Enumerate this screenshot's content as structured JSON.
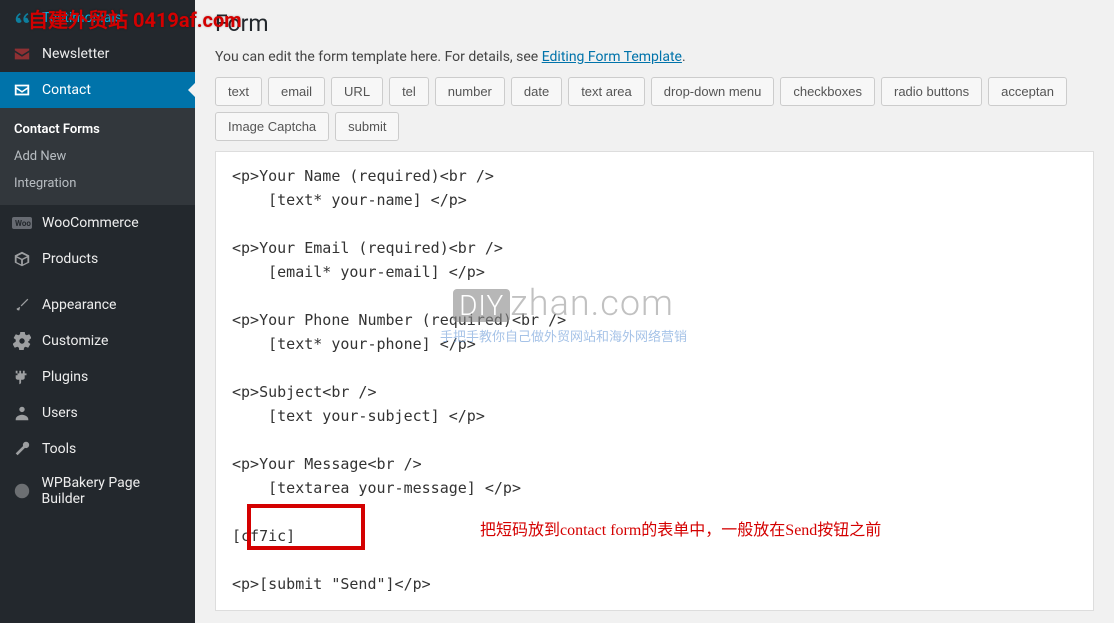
{
  "top_watermark": "自建外贸站 0419af.com",
  "sidebar": {
    "items": [
      {
        "label": "Testimonials",
        "icon": "quote"
      },
      {
        "label": "Newsletter",
        "icon": "mail"
      },
      {
        "label": "Contact",
        "icon": "envelope",
        "active": true
      },
      {
        "label": "WooCommerce",
        "icon": "woo"
      },
      {
        "label": "Products",
        "icon": "box"
      },
      {
        "label": "Appearance",
        "icon": "brush"
      },
      {
        "label": "Customize",
        "icon": "gear"
      },
      {
        "label": "Plugins",
        "icon": "plug"
      },
      {
        "label": "Users",
        "icon": "user"
      },
      {
        "label": "Tools",
        "icon": "wrench"
      },
      {
        "label": "WPBakery Page Builder",
        "icon": "wpb"
      }
    ],
    "submenu": [
      {
        "label": "Contact Forms",
        "current": true
      },
      {
        "label": "Add New"
      },
      {
        "label": "Integration"
      }
    ]
  },
  "panel": {
    "title": "Form",
    "help_prefix": "You can edit the form template here. For details, see ",
    "help_link": "Editing Form Template",
    "help_suffix": ".",
    "tags": [
      "text",
      "email",
      "URL",
      "tel",
      "number",
      "date",
      "text area",
      "drop-down menu",
      "checkboxes",
      "radio buttons",
      "acceptan",
      "Image Captcha",
      "submit"
    ],
    "code": "<p>Your Name (required)<br />\n    [text* your-name] </p>\n\n<p>Your Email (required)<br />\n    [email* your-email] </p>\n\n<p>Your Phone Number (required)<br />\n    [text* your-phone] </p>\n\n<p>Subject<br />\n    [text your-subject] </p>\n\n<p>Your Message<br />\n    [textarea your-message] </p>\n\n[cf7ic]\n\n<p>[submit \"Send\"]</p>"
  },
  "watermark": {
    "main_diy": "DIY",
    "main_rest": "zhan.com",
    "sub": "手把手教你自己做外贸网站和海外网络营销"
  },
  "annotation": "把短码放到contact form的表单中，一般放在Send按钮之前"
}
